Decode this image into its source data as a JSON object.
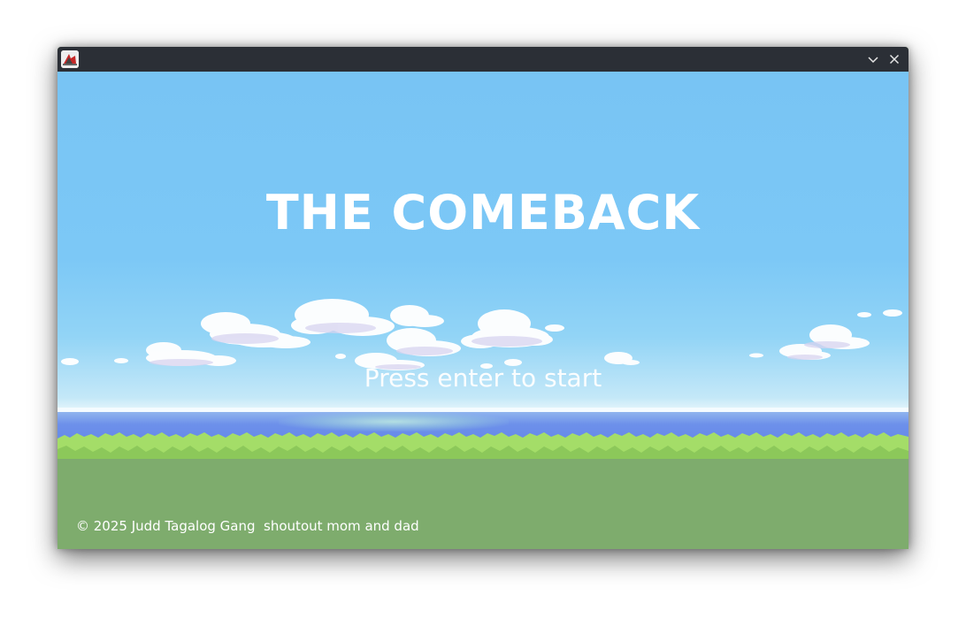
{
  "window": {
    "app_icon": "game-app-icon",
    "minimize_icon": "chevron-down-icon",
    "close_icon": "close-icon"
  },
  "game": {
    "title": "THE COMEBACK",
    "prompt": "Press enter to start",
    "footer": "© 2025 Judd Tagalog Gang  shoutout mom and dad"
  },
  "colors": {
    "titlebar": "#2b2f36",
    "sky": "#78c4f4",
    "sea": "#6388e8",
    "grass": "#a6e06a",
    "field": "#7eac6d",
    "text": "#ffffff"
  }
}
